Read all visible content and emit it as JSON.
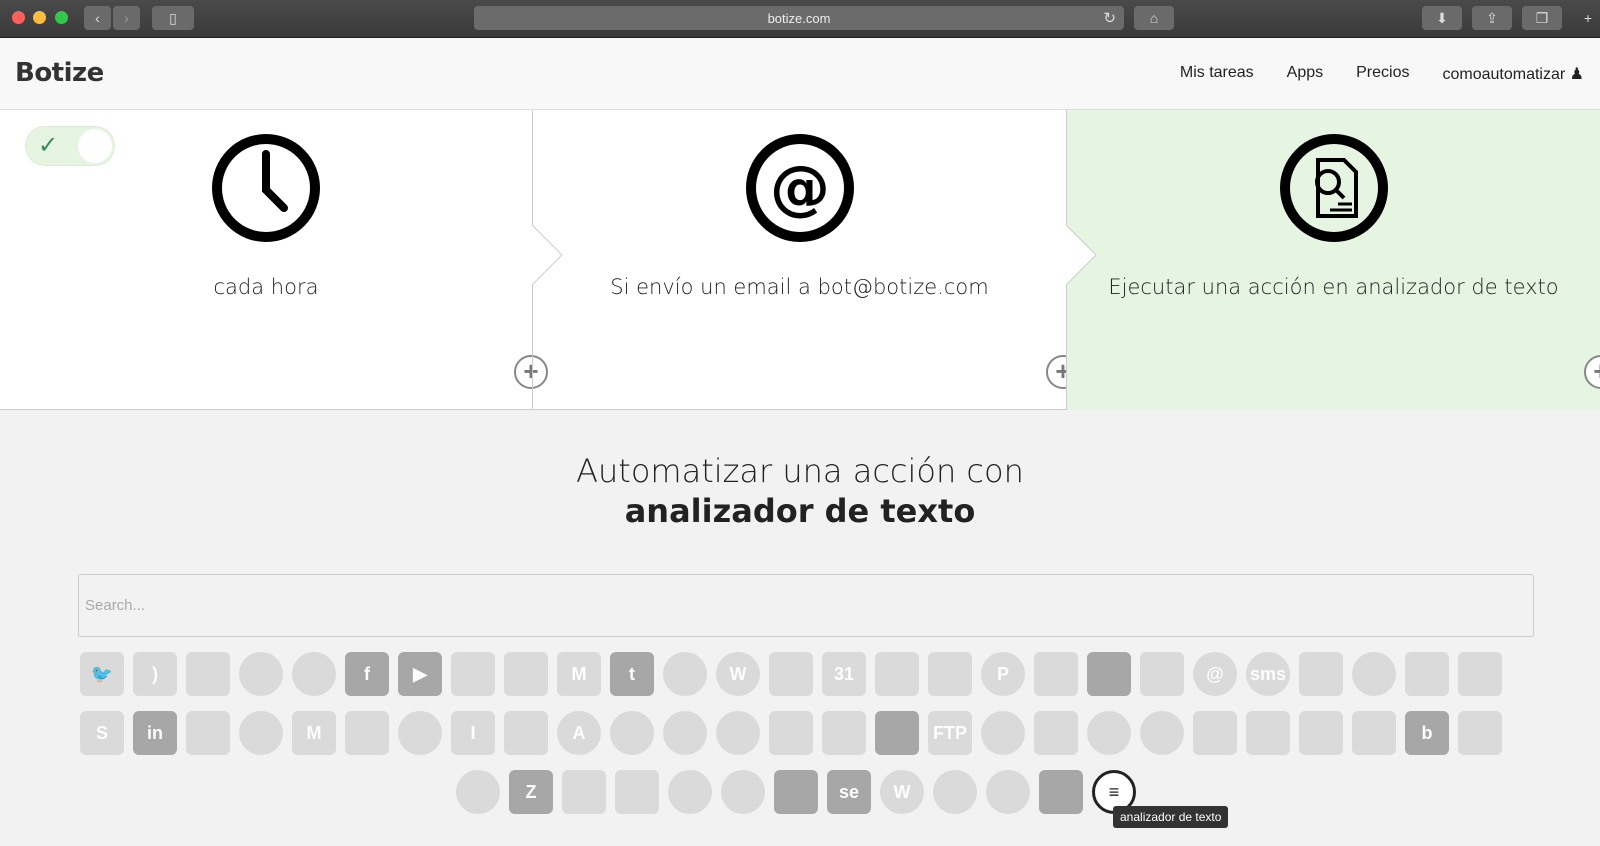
{
  "browser": {
    "url": "botize.com"
  },
  "header": {
    "logo": "Botize",
    "nav": [
      "Mis tareas",
      "Apps",
      "Precios",
      "comoautomatizar"
    ]
  },
  "steps": [
    {
      "label": "cada hora",
      "icon": "clock-icon"
    },
    {
      "label": "Si envío un email a bot@botize.com",
      "icon": "at-icon"
    },
    {
      "label": "Ejecutar una acción en analizador de texto",
      "icon": "text-analyzer-icon"
    }
  ],
  "section": {
    "title_line1": "Automatizar una acción con",
    "title_line2": "analizador de texto",
    "search_placeholder": "Search..."
  },
  "apps_row1": [
    "twitter",
    "rss",
    "facebook-page",
    "lab",
    "instagram",
    "facebook",
    "youtube",
    "yahoo-weather",
    "mailchimp",
    "gmail",
    "tumblr",
    "hand",
    "wordpress-xmlrpc",
    "dropbox",
    "calendar",
    "google-drive",
    "blogger",
    "pinterest",
    "pushpin",
    "botize",
    "pocket",
    "email",
    "sms",
    "evernote",
    "webhooks",
    "todo",
    "sheets"
  ],
  "apps_row2": [
    "slack",
    "linkedin",
    "magnet",
    "mail",
    "gmail-2",
    "zoho-projects",
    "filter",
    "instapaper",
    "box",
    "amazon",
    "chat",
    "list",
    "like",
    "contacts",
    "outlook",
    "document",
    "ftp",
    "paint",
    "analytics",
    "messenger",
    "globe",
    "trello",
    "chart",
    "bars",
    "sheets-2",
    "bing",
    "mysql"
  ],
  "apps_row3": [
    "toggle",
    "zendesk",
    "arch",
    "bars-2",
    "compass",
    "groups",
    "monogram",
    "se",
    "wordpress",
    "sync",
    "doc",
    "block",
    "text-analyzer"
  ],
  "tooltip": "analizador de texto"
}
